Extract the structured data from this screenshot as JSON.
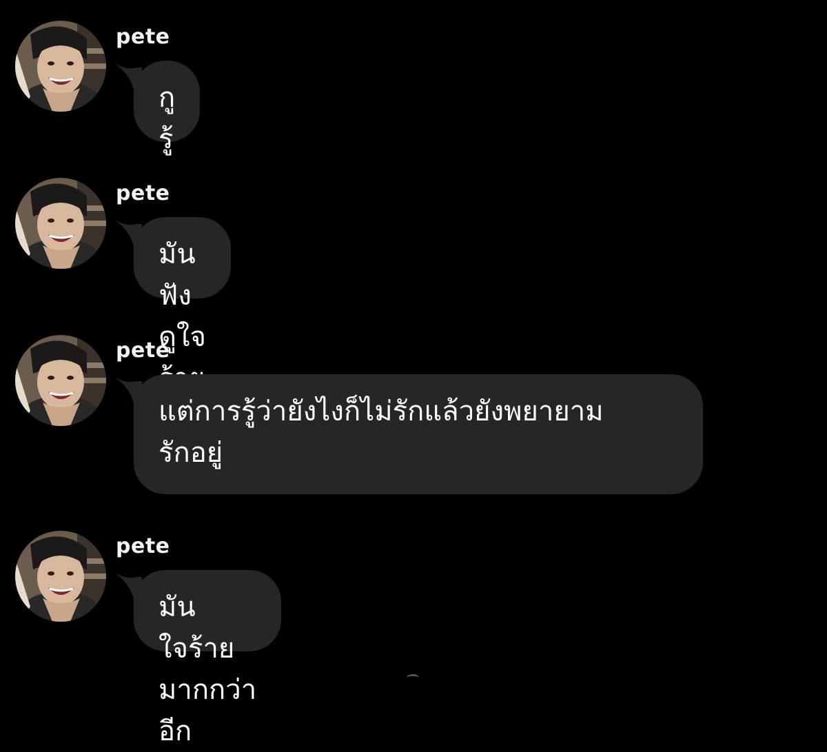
{
  "messages": [
    {
      "sender": "pete",
      "text": "กูรู้",
      "avatar_icon": "profile-photo-smiling-boy"
    },
    {
      "sender": "pete",
      "text": "มันฟังดูใจร้าย",
      "avatar_icon": "profile-photo-smiling-boy"
    },
    {
      "sender": "pete",
      "text": "แต่การรู้ว่ายังไงก็ไม่รักแล้วยังพยายาม\nรักอยู่",
      "avatar_icon": "profile-photo-smiling-boy"
    },
    {
      "sender": "pete",
      "text": "มันใจร้ายมากกว่าอีก",
      "avatar_icon": "profile-photo-smiling-boy"
    }
  ],
  "colors": {
    "background": "#000000",
    "bubble": "#262626",
    "text": "#ffffff",
    "sender": "#f2f2f2"
  }
}
